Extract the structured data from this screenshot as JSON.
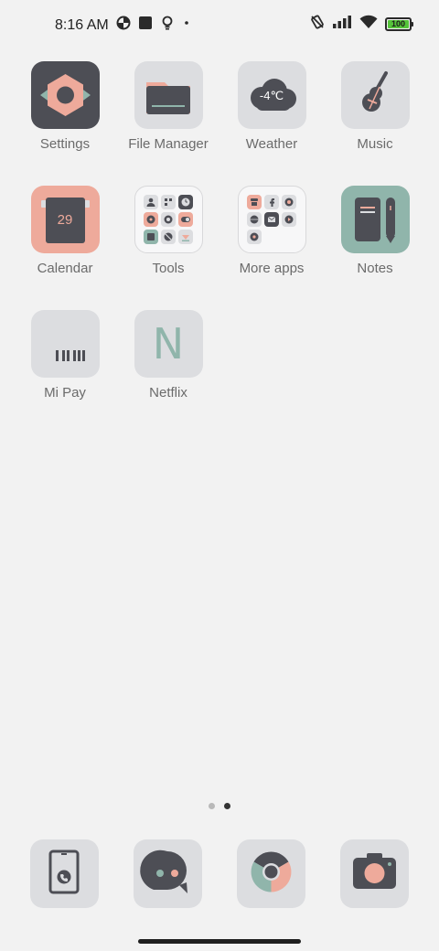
{
  "status_bar": {
    "time": "8:16 AM",
    "left_icons": [
      "pie-chart-icon",
      "square-icon",
      "lightbulb-icon",
      "dot-icon"
    ],
    "right_icons": [
      "vibrate-mute-icon",
      "signal-icon",
      "wifi-icon",
      "battery-icon"
    ],
    "battery_level": "100",
    "battery_color": "#55c43a"
  },
  "apps": [
    {
      "label": "Settings",
      "icon": "settings-gear-icon"
    },
    {
      "label": "File Manager",
      "icon": "folder-icon"
    },
    {
      "label": "Weather",
      "icon": "cloud-icon",
      "value": "-4℃"
    },
    {
      "label": "Music",
      "icon": "guitar-icon"
    },
    {
      "label": "Calendar",
      "icon": "calendar-icon",
      "value": "29"
    },
    {
      "label": "Tools",
      "icon": "folder-grid-icon"
    },
    {
      "label": "More apps",
      "icon": "folder-grid-icon"
    },
    {
      "label": "Notes",
      "icon": "notebook-icon"
    },
    {
      "label": "Mi Pay",
      "icon": "barcode-icon"
    },
    {
      "label": "Netflix",
      "icon": "netflix-n-icon",
      "value": "N"
    }
  ],
  "page_indicator": {
    "count": 2,
    "active_index": 1
  },
  "dock": [
    {
      "name": "phone",
      "icon": "phone-icon"
    },
    {
      "name": "messaging",
      "icon": "chat-bubble-icon"
    },
    {
      "name": "browser",
      "icon": "chrome-icon"
    },
    {
      "name": "camera",
      "icon": "camera-icon"
    }
  ],
  "colors": {
    "background": "#f2f2f2",
    "icon_tile": "#dcdde0",
    "dark": "#4d4e55",
    "salmon": "#eeaa9b",
    "sage": "#90b5ab"
  }
}
